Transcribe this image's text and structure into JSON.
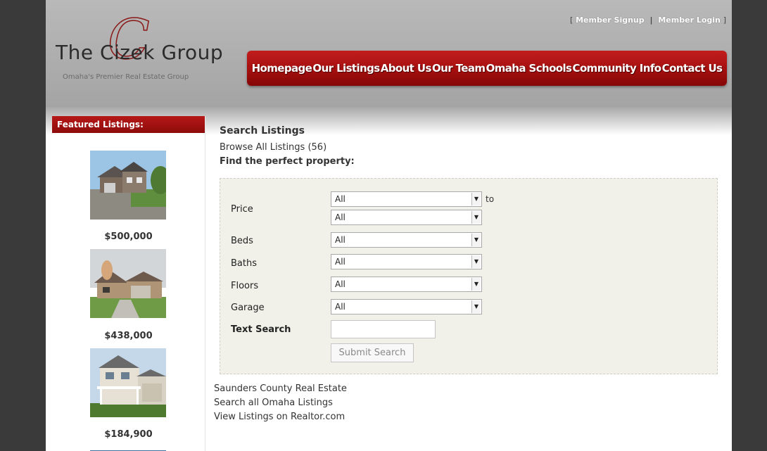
{
  "header": {
    "logo_name": "The Cizek Group",
    "logo_tagline": "Omaha's Premier Real Estate Group",
    "member_links": [
      "Member Signup",
      "Member Login"
    ],
    "nav_items": [
      "Homepage",
      "Our Listings",
      "About Us",
      "Our Team",
      "Omaha Schools",
      "Community Info",
      "Contact Us"
    ]
  },
  "sidebar": {
    "heading": "Featured Listings:",
    "listings": [
      {
        "price": "$500,000"
      },
      {
        "price": "$438,000"
      },
      {
        "price": "$184,900"
      }
    ]
  },
  "search": {
    "title": "Search Listings",
    "browse_link": "Browse All Listings (56)",
    "subtitle": "Find the perfect property:",
    "labels": {
      "price": "Price",
      "beds": "Beds",
      "baths": "Baths",
      "floors": "Floors",
      "garage": "Garage",
      "text_search": "Text Search"
    },
    "values": {
      "price_min": "All",
      "price_max": "All",
      "beds": "All",
      "baths": "All",
      "floors": "All",
      "garage": "All"
    },
    "to_label": "to",
    "text_value": "",
    "submit_label": "Submit Search"
  },
  "bottom_links": [
    "Saunders County Real Estate",
    "Search all Omaha Listings",
    "View Listings on Realtor.com"
  ],
  "colors": {
    "brand_red": "#a40f0f",
    "header_gray": "#b0b0b0",
    "form_bg": "#f1f1ea"
  }
}
